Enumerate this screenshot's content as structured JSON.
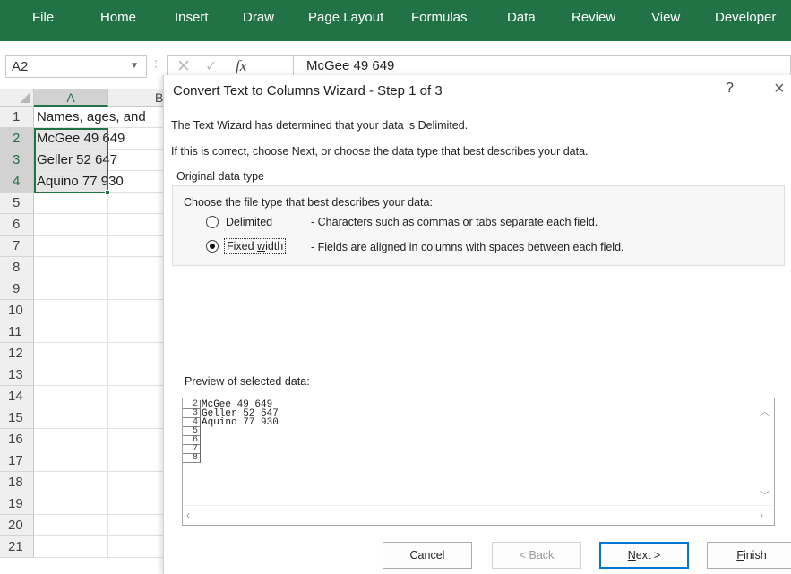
{
  "ribbon": {
    "tabs": [
      "File",
      "Home",
      "Insert",
      "Draw",
      "Page Layout",
      "Formulas",
      "Data",
      "Review",
      "View",
      "Developer"
    ]
  },
  "formula_bar": {
    "name_box": "A2",
    "fx": "fx",
    "content": "McGee 49 649"
  },
  "sheet": {
    "columns": [
      "A",
      "B"
    ],
    "rows": [
      "1",
      "2",
      "3",
      "4",
      "5",
      "6",
      "7",
      "8",
      "9",
      "10",
      "11",
      "12",
      "13",
      "14",
      "15",
      "16",
      "17",
      "18",
      "19",
      "20",
      "21"
    ],
    "cells": {
      "A1": "Names, ages, and",
      "A2": "McGee 49 649",
      "A3": "Geller 52 647",
      "A4": "Aquino 77 930"
    }
  },
  "dialog": {
    "title": "Convert Text to Columns Wizard - Step 1 of 3",
    "help": "?",
    "close": "×",
    "line1": "The Text Wizard has determined that your data is Delimited.",
    "line2": "If this is correct, choose Next, or choose the data type that best describes your data.",
    "group_title": "Original data type",
    "choose_label": "Choose the file type that best describes your data:",
    "options": [
      {
        "label_first": "D",
        "label_rest": "elimited",
        "desc": "- Characters such as commas or tabs separate each field.",
        "selected": false
      },
      {
        "label_first": "Fixed ",
        "label_under": "w",
        "label_rest": "idth",
        "desc": "- Fields are aligned in columns with spaces between each field.",
        "selected": true
      }
    ],
    "preview_label": "Preview of selected data:",
    "preview_row_numbers": [
      "2",
      "3",
      "4",
      "5",
      "6",
      "7",
      "8"
    ],
    "preview_lines": [
      "McGee 49 649",
      "Geller 52 647",
      "Aquino 77 930",
      "",
      "",
      "",
      ""
    ],
    "buttons": {
      "cancel": "Cancel",
      "back": "< Back",
      "next_first": "N",
      "next_rest": "ext >",
      "finish_first": "F",
      "finish_rest": "inish"
    }
  },
  "colors": {
    "ribbon": "#217346",
    "selection": "#217346",
    "default_button_border": "#0078d7"
  }
}
